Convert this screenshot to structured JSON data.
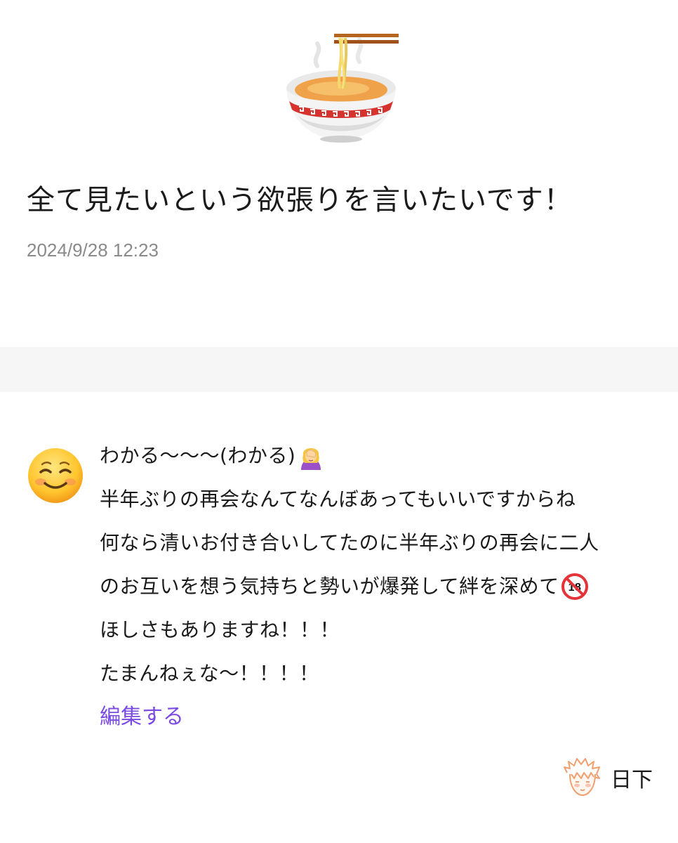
{
  "question": {
    "icon": "ramen-bowl-icon",
    "title": "全て見たいという欲張りを言いたいです！",
    "timestamp": "2024/9/28 12:23"
  },
  "answer": {
    "avatar_icon": "smiling-face-emoji",
    "lines": [
      "わかる〜〜〜(わかる)",
      "半年ぶりの再会なんてなんぼあってもいいですからね",
      "何なら清いお付き合いしてたのに半年ぶりの再会に二人",
      "のお互いを想う気持ちと勢いが爆発して絆を深めて",
      "ほしさもありますね！！！",
      "たまんねぇな〜！！！！"
    ],
    "inline_icons": [
      "facepalm-woman-emoji",
      "no-under-18-emoji"
    ],
    "edit_label": "編集する"
  },
  "author": {
    "avatar_icon": "anime-boy-avatar-icon",
    "name": "日下"
  },
  "colors": {
    "accent": "#7b4ae2",
    "timestamp": "#8a8a8a",
    "divider": "#f6f6f6"
  }
}
